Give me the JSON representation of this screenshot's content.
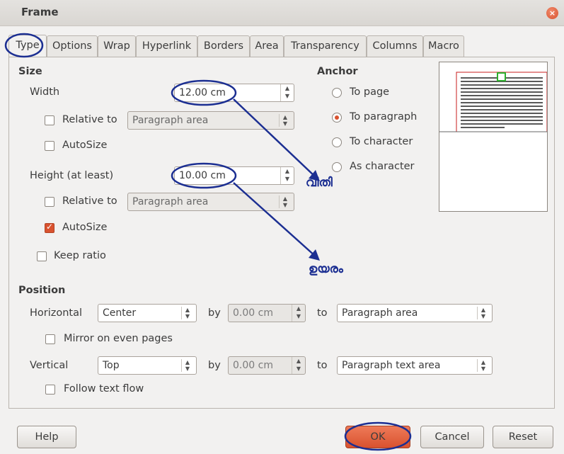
{
  "window": {
    "title": "Frame",
    "close_icon": "×"
  },
  "tabs": [
    "Type",
    "Options",
    "Wrap",
    "Hyperlink",
    "Borders",
    "Area",
    "Transparency",
    "Columns",
    "Macro"
  ],
  "size": {
    "header": "Size",
    "width_label": "Width",
    "width_value": "12.00 cm",
    "width_relative_label": "Relative to",
    "width_relative_value": "Paragraph area",
    "width_autosize_label": "AutoSize",
    "height_label": "Height (at least)",
    "height_value": "10.00 cm",
    "height_relative_label": "Relative to",
    "height_relative_value": "Paragraph area",
    "height_autosize_label": "AutoSize",
    "keep_ratio_label": "Keep ratio"
  },
  "anchor": {
    "header": "Anchor",
    "options": [
      "To page",
      "To paragraph",
      "To character",
      "As character"
    ],
    "selected": "To paragraph"
  },
  "annotations": {
    "width_note": "വീതി",
    "height_note": "ഉയരം"
  },
  "position": {
    "header": "Position",
    "horizontal_label": "Horizontal",
    "horizontal_value": "Center",
    "by_label": "by",
    "horizontal_by": "0.00 cm",
    "to_label": "to",
    "horizontal_to": "Paragraph area",
    "mirror_label": "Mirror on even pages",
    "vertical_label": "Vertical",
    "vertical_value": "Top",
    "vertical_by": "0.00 cm",
    "vertical_to": "Paragraph text area",
    "follow_label": "Follow text flow"
  },
  "buttons": {
    "help": "Help",
    "ok": "OK",
    "cancel": "Cancel",
    "reset": "Reset"
  },
  "colors": {
    "accent": "#d9522f",
    "annotation": "#1c2f92"
  }
}
